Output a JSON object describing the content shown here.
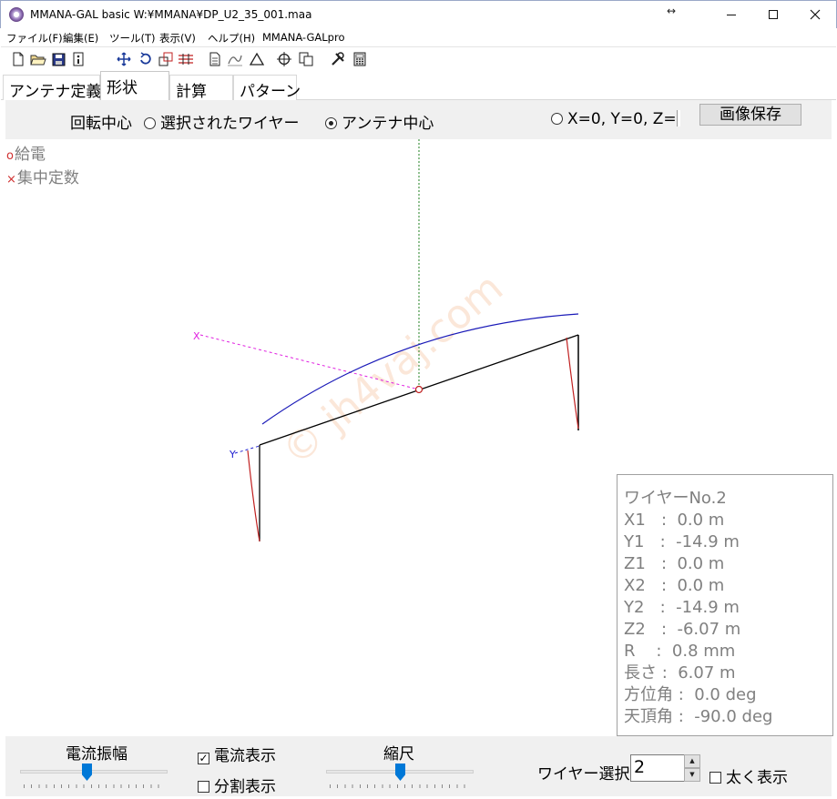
{
  "window": {
    "title": "MMANA-GAL basic  W:¥MMANA¥DP_U2_35_001.maa",
    "resize_glyph": "↔"
  },
  "menu": [
    "ファイル(F)",
    "編集(E)",
    "ツール(T)",
    "表示(V)",
    "ヘルプ(H)",
    "MMANA-GALpro"
  ],
  "toolbar_icons": [
    "new-file-icon",
    "open-folder-icon",
    "save-disk-icon",
    "info-icon",
    "move-arrows-icon",
    "rotate-icon",
    "zoom-window-icon",
    "wire-edit-icon",
    "document-icon",
    "draw-icon",
    "triangle-icon",
    "target-icon",
    "copy-icon",
    "tools-icon",
    "calculator-icon"
  ],
  "tabs": [
    "アンテナ定義",
    "形状",
    "計算",
    "パターン"
  ],
  "active_tab": "形状",
  "rotation": {
    "label": "回転中心",
    "opt_selected_wire": "選択されたワイヤー",
    "opt_antenna_center": "アンテナ中心",
    "opt_origin": "X=0, Y=0, Z=",
    "selected": "アンテナ中心",
    "save_button": "画像保存"
  },
  "legend": {
    "feed": "給電",
    "lumped": "集中定数"
  },
  "axes": {
    "x_label": "X",
    "y_label": "Y"
  },
  "watermark": "© jh4vaj.com",
  "wire_info": {
    "title": "ワイヤーNo.2",
    "rows": [
      "X1   :  0.0 m",
      "Y1   :  -14.9 m",
      "Z1   :  0.0 m",
      "X2   :  0.0 m",
      "Y2   :  -14.9 m",
      "Z2   :  -6.07 m",
      "R    :  0.8 mm",
      "長さ :  6.07 m",
      "方位角 :  0.0 deg",
      "天頂角 :  -90.0 deg"
    ]
  },
  "bottom": {
    "current_amplitude_label": "電流振幅",
    "current_amplitude_level": 0.45,
    "show_current": "電流表示",
    "show_current_checked": true,
    "show_segments": "分割表示",
    "show_segments_checked": false,
    "scale_label": "縮尺",
    "scale_level": 0.5,
    "wire_select_label": "ワイヤー選択",
    "wire_select_value": "2",
    "bold_display": "太く表示",
    "bold_display_checked": false
  },
  "colors": {
    "current_curve": "#1a1ab8",
    "wire": "#000000",
    "x_axis": "#e020e0",
    "z_axis": "#208020",
    "y_axis": "#2020d0",
    "vertical_current": "#c02020",
    "slider_thumb": "#0078d7"
  }
}
